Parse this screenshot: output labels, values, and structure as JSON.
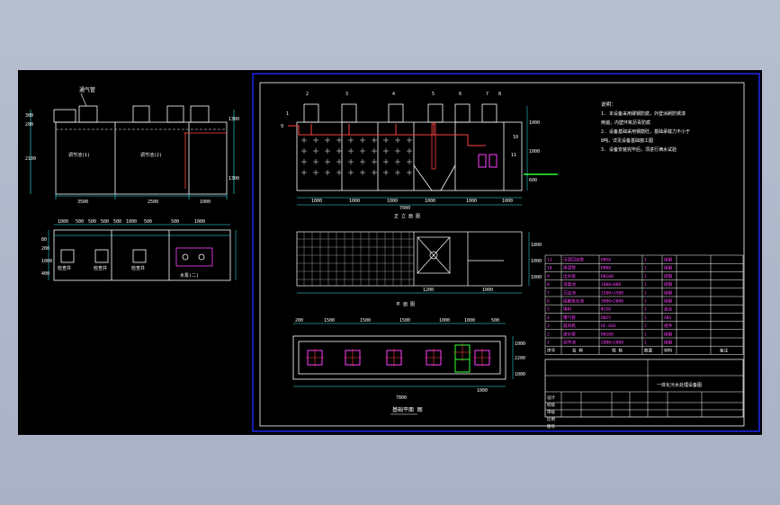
{
  "drawing": {
    "left_sheet": {
      "top_label": "通气管",
      "tank_label_1": "调节池(1)",
      "tank_label_2": "调节池(2)",
      "dim_bottom": [
        "3500",
        "2500",
        "1000"
      ],
      "dim_left": [
        "300",
        "200",
        "2100"
      ],
      "dim_right": [
        "1300",
        "1300"
      ],
      "plan_dims_top": [
        "1000",
        "500",
        "500",
        "500",
        "500",
        "1000",
        "500",
        "500",
        "1000"
      ],
      "plan_labels": [
        "检查井",
        "检查井",
        "检查井",
        "水泵(二)"
      ],
      "plan_dims_left": [
        "80",
        "200",
        "1000",
        "400"
      ]
    },
    "main_sheet": {
      "elevation_title": "正 立 面 图",
      "plan_title": "平 面 图",
      "bottom_plan_title": "基础平面 图",
      "elev_dims": [
        "1000",
        "1000",
        "1000",
        "1000",
        "1000",
        "1000"
      ],
      "elev_total": "7000",
      "right_dims": [
        "1000",
        "1000",
        "600"
      ],
      "plan_dims_right": [
        "1800",
        "1000",
        "1000"
      ],
      "plan_dim_bottom": [
        "1200",
        "1000"
      ],
      "foundation_dims_top": [
        "200",
        "1500",
        "1500",
        "1500",
        "1000",
        "1000",
        "500"
      ],
      "foundation_total": "7800",
      "foundation_dims_right": [
        "1000",
        "2200",
        "1000"
      ],
      "foundation_dim_bottom": "1000",
      "callouts": [
        "1",
        "2",
        "3",
        "4",
        "5",
        "6",
        "7",
        "8",
        "9",
        "10",
        "11"
      ],
      "notes_title": "说明：",
      "notes": [
        "1. 本设备采用碳钢防腐，外壁涂刷防锈漆",
        "   两遍，内壁环氧沥青防腐",
        "2. 设备基础采用钢筋砼，基础承载力不小于",
        "   8吨，详见设备基础施工图",
        "3. 设备安装完毕后，须进行满水试验"
      ]
    },
    "table": {
      "rows": [
        [
          "11",
          "污泥回流管",
          "DN50",
          "1",
          "碳钢"
        ],
        [
          "10",
          "排泥管",
          "DN80",
          "1",
          "碳钢"
        ],
        [
          "9",
          "出水管",
          "DN100",
          "1",
          "碳钢"
        ],
        [
          "8",
          "消毒池",
          "1000×800",
          "1",
          "碳钢"
        ],
        [
          "7",
          "沉淀池",
          "1500×1500",
          "1",
          "碳钢"
        ],
        [
          "6",
          "接触氧化池",
          "3000×2000",
          "1",
          "碳钢"
        ],
        [
          "5",
          "填料",
          "Φ150",
          "1",
          "组合"
        ],
        [
          "4",
          "曝气管",
          "DN25",
          "1",
          "ABS"
        ],
        [
          "3",
          "鼓风机",
          "HC-60S",
          "2",
          "组件"
        ],
        [
          "2",
          "进水管",
          "DN100",
          "1",
          "碳钢"
        ],
        [
          "1",
          "调节池",
          "2000×2000",
          "1",
          "碳钢"
        ]
      ],
      "header": [
        "序号",
        "名 称",
        "规 格",
        "数量",
        "材料",
        "备注"
      ],
      "title_block_name": "一体化污水处理设备图",
      "title_block_cells": [
        "设计",
        "校核",
        "审核",
        "比例",
        "图号"
      ]
    }
  },
  "colors": {
    "background": "#000000",
    "frame": "#1e2bff",
    "line": "#ffffff",
    "dim_line": "#35f0ff",
    "pipe": "#ff3333",
    "equipment": "#ff40ff",
    "highlight": "#33ff33",
    "hatch": "#cccccc"
  }
}
